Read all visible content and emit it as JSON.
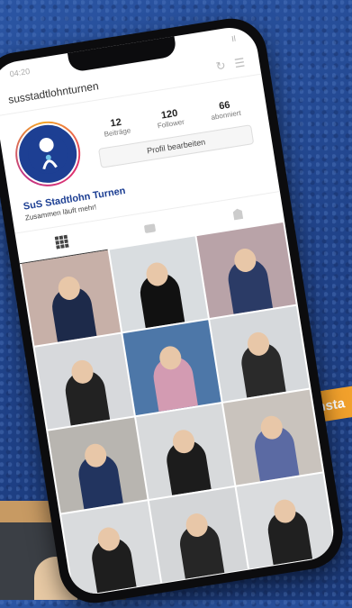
{
  "status": {
    "time": "04:20",
    "signal": "Il"
  },
  "header": {
    "username": "susstadtlohnturnen"
  },
  "profile": {
    "stats": [
      {
        "value": "12",
        "label": "Beiträge"
      },
      {
        "value": "120",
        "label": "Follower"
      },
      {
        "value": "66",
        "label": "abonniert"
      }
    ],
    "edit_label": "Profil bearbeiten",
    "name": "SuS Stadtlohn Turnen",
    "bio": "Zusammen läuft mehr!"
  },
  "tabs": [
    {
      "icon": "grid-icon",
      "active": true
    },
    {
      "icon": "igtv-icon",
      "active": false
    },
    {
      "icon": "tagged-icon",
      "active": false
    }
  ],
  "posts": [
    {
      "theme": "gym-split",
      "bg": "#c7b0a8",
      "fig": "#1d2a4a"
    },
    {
      "theme": "man-portrait",
      "bg": "#d9dde0",
      "fig": "#111"
    },
    {
      "theme": "gym-stretch",
      "bg": "#b9a3a8",
      "fig": "#2b3b66"
    },
    {
      "theme": "girl-portrait",
      "bg": "#d7d9dc",
      "fig": "#222"
    },
    {
      "theme": "gym-group",
      "bg": "#4d77a8",
      "fig": "#d39bb2"
    },
    {
      "theme": "girl-portrait-2",
      "bg": "#d6d9dc",
      "fig": "#2a2a2a"
    },
    {
      "theme": "gym-hall",
      "bg": "#b8b5b0",
      "fig": "#22345f"
    },
    {
      "theme": "girl-smile",
      "bg": "#d8dadc",
      "fig": "#1c1c1c"
    },
    {
      "theme": "gym-jump",
      "bg": "#c9c3bd",
      "fig": "#5b6aa3"
    },
    {
      "theme": "girl-blond",
      "bg": "#d9dbdd",
      "fig": "#1e1e1e"
    },
    {
      "theme": "girl-blond-2",
      "bg": "#d4d6d8",
      "fig": "#262626"
    },
    {
      "theme": "girl-blond-3",
      "bg": "#dadcde",
      "fig": "#202020"
    }
  ],
  "side_badge": "insta",
  "colors": {
    "brand": "#1d3f93",
    "accent": "#f2a12c"
  }
}
